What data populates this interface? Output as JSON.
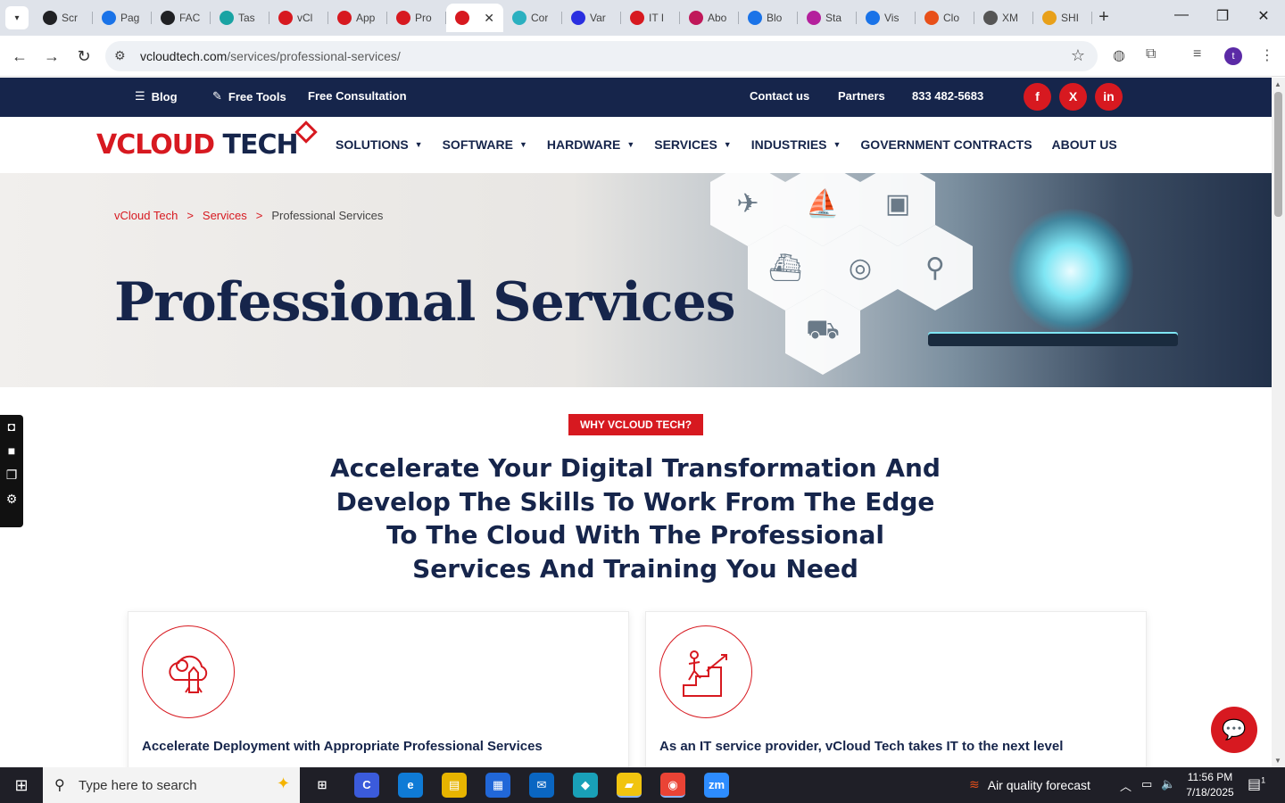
{
  "browser": {
    "tabs": [
      {
        "label": "Scr",
        "color": "#202124"
      },
      {
        "label": "Pag",
        "color": "#1a73e8"
      },
      {
        "label": "FAC",
        "color": "#202124"
      },
      {
        "label": "Tas",
        "color": "#1aa3a3"
      },
      {
        "label": "vCl",
        "color": "#d71920"
      },
      {
        "label": "App",
        "color": "#d71920"
      },
      {
        "label": "Pro",
        "color": "#d71920"
      },
      {
        "label": "",
        "color": "#d71920",
        "active": true
      },
      {
        "label": "Cor",
        "color": "#2bb0c0"
      },
      {
        "label": "Var",
        "color": "#2a2fe0"
      },
      {
        "label": "IT I",
        "color": "#d71920"
      },
      {
        "label": "Abo",
        "color": "#c0185a"
      },
      {
        "label": "Blo",
        "color": "#1a73e8"
      },
      {
        "label": "Sta",
        "color": "#b4209c"
      },
      {
        "label": "Vis",
        "color": "#1a73e8"
      },
      {
        "label": "Clo",
        "color": "#e8501a"
      },
      {
        "label": "XM",
        "color": "#555555"
      },
      {
        "label": "SHI",
        "color": "#e8a01a"
      }
    ],
    "url_domain": "vcloudtech.com",
    "url_path": "/services/professional-services/",
    "profile_initial": "t"
  },
  "site": {
    "topbar": {
      "blog": "Blog",
      "free_tools": "Free Tools",
      "free_consultation": "Free Consultation",
      "contact": "Contact us",
      "partners": "Partners",
      "phone": "833 482-5683"
    },
    "social": {
      "facebook": "f",
      "x": "X",
      "linkedin": "in"
    },
    "logo": {
      "part1": "VCLOUD",
      "part2": "TECH"
    },
    "menu": [
      {
        "label": "SOLUTIONS",
        "dropdown": true
      },
      {
        "label": "SOFTWARE",
        "dropdown": true
      },
      {
        "label": "HARDWARE",
        "dropdown": true
      },
      {
        "label": "SERVICES",
        "dropdown": true
      },
      {
        "label": "INDUSTRIES",
        "dropdown": true
      },
      {
        "label": "GOVERNMENT CONTRACTS",
        "dropdown": false
      },
      {
        "label": "ABOUT US",
        "dropdown": false
      }
    ],
    "breadcrumb": {
      "home": "vCloud Tech",
      "separator": ">",
      "section": "Services",
      "current": "Professional Services"
    },
    "hero_title": "Professional Services",
    "why_badge": "WHY VCLOUD TECH?",
    "headline": "Accelerate Your Digital Transformation And Develop The Skills To Work From The Edge To The Cloud With The Professional Services And Training You Need",
    "cards": [
      {
        "title": "Accelerate Deployment with Appropriate Professional Services",
        "icon": "cloud-gear-rocket-icon"
      },
      {
        "title": "As an IT service provider, vCloud Tech takes IT to the next level",
        "icon": "person-climbing-steps-icon"
      }
    ],
    "brand_red": "#d71920",
    "brand_navy": "#16254b"
  },
  "taskbar": {
    "search_placeholder": "Type here to search",
    "weather": "Air quality forecast",
    "time": "11:56 PM",
    "date": "7/18/2025",
    "notification_count": "1",
    "apps": [
      {
        "name": "task-view",
        "label": "⊞"
      },
      {
        "name": "copilot",
        "label": "C"
      },
      {
        "name": "edge",
        "label": "e"
      },
      {
        "name": "file-explorer",
        "label": "▤"
      },
      {
        "name": "store",
        "label": "▦"
      },
      {
        "name": "mail",
        "label": "✉"
      },
      {
        "name": "app-teal",
        "label": "◆"
      },
      {
        "name": "sticky-notes",
        "label": "▰"
      },
      {
        "name": "chrome",
        "label": "◉"
      },
      {
        "name": "zoom",
        "label": "zm"
      }
    ]
  }
}
